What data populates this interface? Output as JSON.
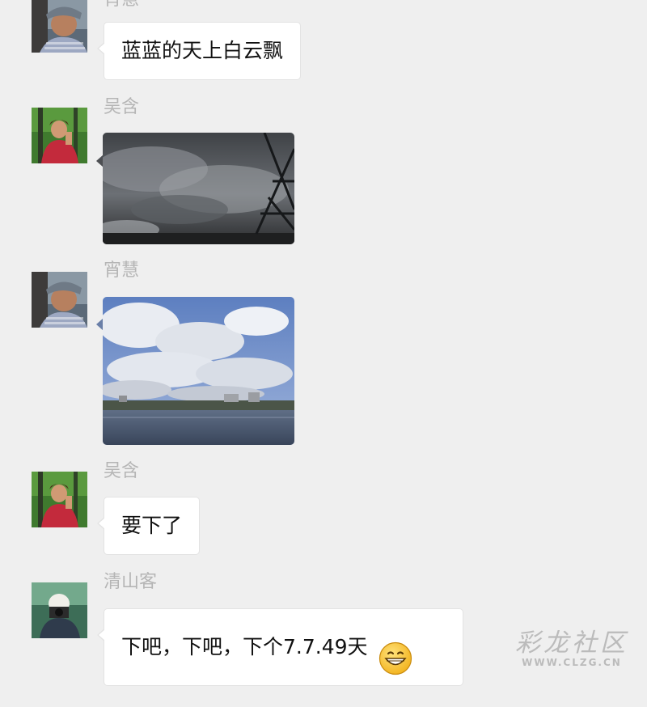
{
  "messages": [
    {
      "type": "text",
      "sender": "宵慧",
      "avatar": "person-cap-avatar",
      "text": "蓝蓝的天上白云飘"
    },
    {
      "type": "image",
      "sender": "吴含",
      "avatar": "person-red-jacket-avatar",
      "image": "dark-storm-clouds-photo"
    },
    {
      "type": "image",
      "sender": "宵慧",
      "avatar": "person-cap-avatar",
      "image": "blue-sky-white-clouds-lake-photo"
    },
    {
      "type": "text",
      "sender": "吴含",
      "avatar": "person-red-jacket-avatar",
      "text": "要下了"
    },
    {
      "type": "text",
      "sender": "清山客",
      "avatar": "person-camera-avatar",
      "text": "下吧，下吧，下个7.7.49天",
      "emoji": "grinning-face-emoji"
    }
  ],
  "watermark": {
    "main": "彩龙社区",
    "url": "WWW.CLZG.CN"
  },
  "colors": {
    "background": "#efefef",
    "bubble": "#ffffff",
    "sender_name": "#b5b5b5"
  }
}
